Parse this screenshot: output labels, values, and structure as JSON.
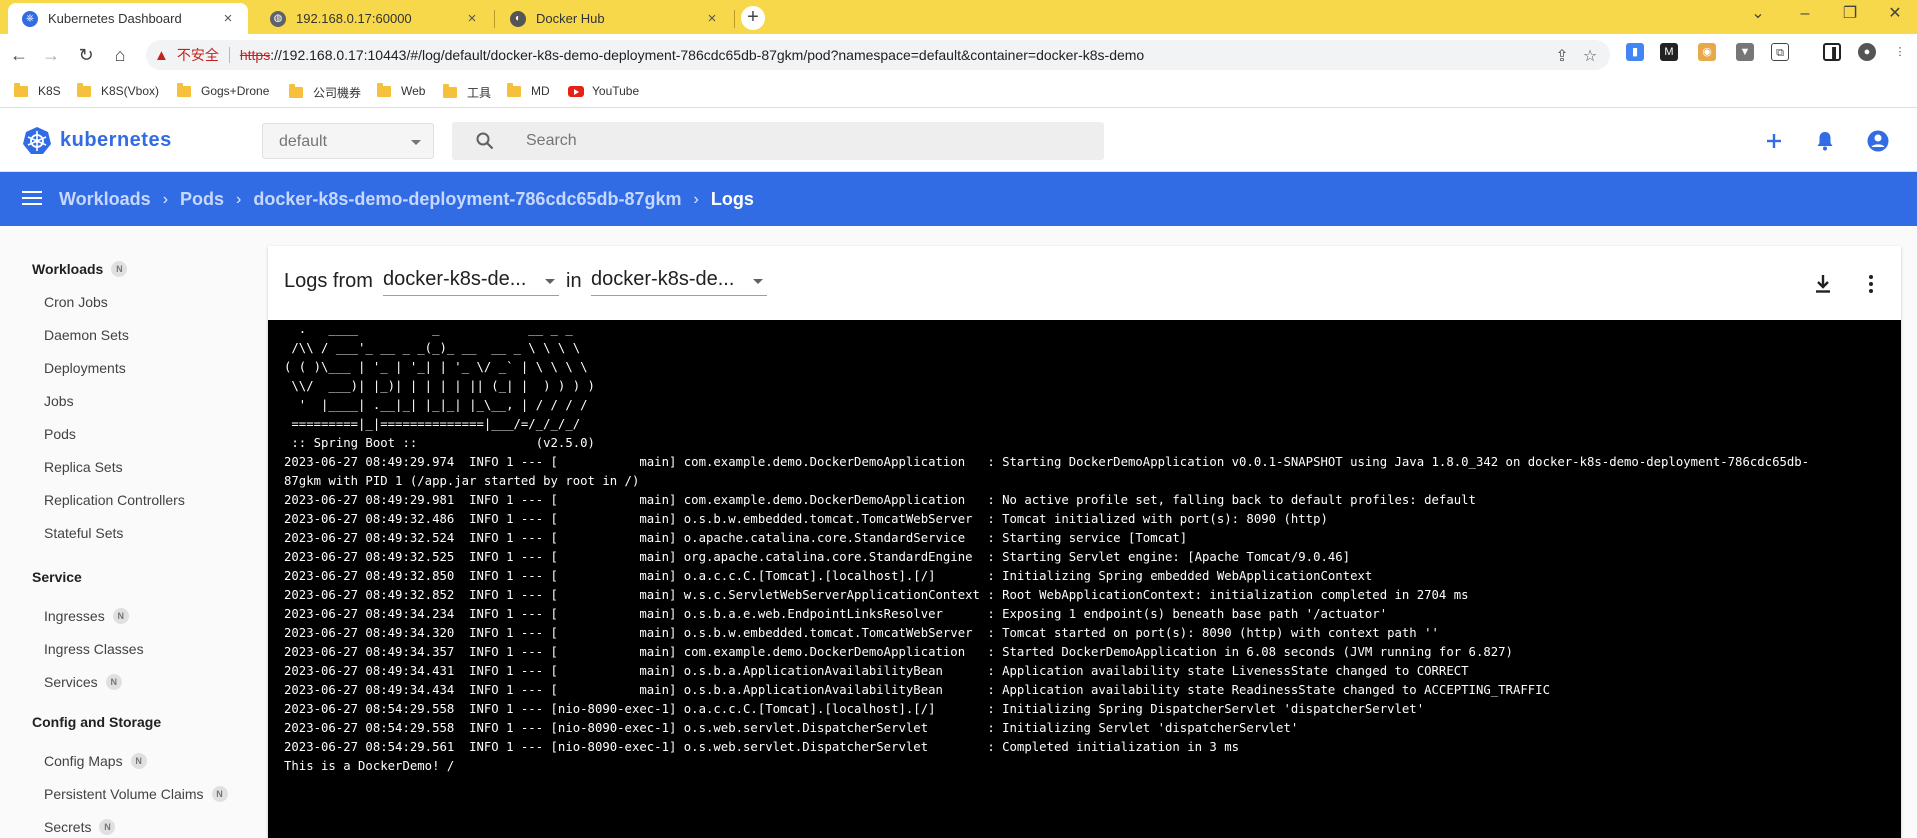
{
  "browser": {
    "tabs": [
      {
        "title": "Kubernetes Dashboard",
        "active": true
      },
      {
        "title": "192.168.0.17:60000",
        "active": false
      },
      {
        "title": "Docker Hub",
        "active": false
      }
    ],
    "address": {
      "security_label": "不安全",
      "protocol": "https",
      "url_rest": "://192.168.0.17:10443/#/log/default/docker-k8s-demo-deployment-786cdc65db-87gkm/pod?namespace=default&container=docker-k8s-demo"
    },
    "bookmarks": [
      "K8S",
      "K8S(Vbox)",
      "Gogs+Drone",
      "公司機券",
      "Web",
      "工具",
      "MD",
      "YouTube"
    ]
  },
  "header": {
    "brand": "kubernetes",
    "namespace": "default",
    "search_placeholder": "Search"
  },
  "breadcrumb": {
    "items": [
      "Workloads",
      "Pods",
      "docker-k8s-demo-deployment-786cdc65db-87gkm"
    ],
    "current": "Logs"
  },
  "sidebar": {
    "sections": [
      {
        "title": "Workloads",
        "badge": "N",
        "items": [
          {
            "label": "Cron Jobs"
          },
          {
            "label": "Daemon Sets"
          },
          {
            "label": "Deployments"
          },
          {
            "label": "Jobs"
          },
          {
            "label": "Pods"
          },
          {
            "label": "Replica Sets"
          },
          {
            "label": "Replication Controllers"
          },
          {
            "label": "Stateful Sets"
          }
        ]
      },
      {
        "title": "Service",
        "items": [
          {
            "label": "Ingresses",
            "badge": "N"
          },
          {
            "label": "Ingress Classes"
          },
          {
            "label": "Services",
            "badge": "N"
          }
        ]
      },
      {
        "title": "Config and Storage",
        "items": [
          {
            "label": "Config Maps",
            "badge": "N"
          },
          {
            "label": "Persistent Volume Claims",
            "badge": "N"
          },
          {
            "label": "Secrets",
            "badge": "N"
          }
        ]
      }
    ]
  },
  "logs": {
    "from_label": "Logs from",
    "pod_select": "docker-k8s-de...",
    "in_label": "in",
    "container_select": "docker-k8s-de...",
    "lines": [
      "  .   ____          _            __ _ _",
      " /\\\\ / ___'_ __ _ _(_)_ __  __ _ \\ \\ \\ \\",
      "( ( )\\___ | '_ | '_| | '_ \\/ _` | \\ \\ \\ \\",
      " \\\\/  ___)| |_)| | | | | || (_| |  ) ) ) )",
      "  '  |____| .__|_| |_|_| |_\\__, | / / / /",
      " =========|_|==============|___/=/_/_/_/",
      " :: Spring Boot ::                (v2.5.0)",
      "2023-06-27 08:49:29.974  INFO 1 --- [           main] com.example.demo.DockerDemoApplication   : Starting DockerDemoApplication v0.0.1-SNAPSHOT using Java 1.8.0_342 on docker-k8s-demo-deployment-786cdc65db-",
      "87gkm with PID 1 (/app.jar started by root in /)",
      "2023-06-27 08:49:29.981  INFO 1 --- [           main] com.example.demo.DockerDemoApplication   : No active profile set, falling back to default profiles: default",
      "2023-06-27 08:49:32.486  INFO 1 --- [           main] o.s.b.w.embedded.tomcat.TomcatWebServer  : Tomcat initialized with port(s): 8090 (http)",
      "2023-06-27 08:49:32.524  INFO 1 --- [           main] o.apache.catalina.core.StandardService   : Starting service [Tomcat]",
      "2023-06-27 08:49:32.525  INFO 1 --- [           main] org.apache.catalina.core.StandardEngine  : Starting Servlet engine: [Apache Tomcat/9.0.46]",
      "2023-06-27 08:49:32.850  INFO 1 --- [           main] o.a.c.c.C.[Tomcat].[localhost].[/]       : Initializing Spring embedded WebApplicationContext",
      "2023-06-27 08:49:32.852  INFO 1 --- [           main] w.s.c.ServletWebServerApplicationContext : Root WebApplicationContext: initialization completed in 2704 ms",
      "2023-06-27 08:49:34.234  INFO 1 --- [           main] o.s.b.a.e.web.EndpointLinksResolver      : Exposing 1 endpoint(s) beneath base path '/actuator'",
      "2023-06-27 08:49:34.320  INFO 1 --- [           main] o.s.b.w.embedded.tomcat.TomcatWebServer  : Tomcat started on port(s): 8090 (http) with context path ''",
      "2023-06-27 08:49:34.357  INFO 1 --- [           main] com.example.demo.DockerDemoApplication   : Started DockerDemoApplication in 6.08 seconds (JVM running for 6.827)",
      "2023-06-27 08:49:34.431  INFO 1 --- [           main] o.s.b.a.ApplicationAvailabilityBean      : Application availability state LivenessState changed to CORRECT",
      "2023-06-27 08:49:34.434  INFO 1 --- [           main] o.s.b.a.ApplicationAvailabilityBean      : Application availability state ReadinessState changed to ACCEPTING_TRAFFIC",
      "2023-06-27 08:54:29.558  INFO 1 --- [nio-8090-exec-1] o.a.c.c.C.[Tomcat].[localhost].[/]       : Initializing Spring DispatcherServlet 'dispatcherServlet'",
      "2023-06-27 08:54:29.558  INFO 1 --- [nio-8090-exec-1] o.s.web.servlet.DispatcherServlet        : Initializing Servlet 'dispatcherServlet'",
      "2023-06-27 08:54:29.561  INFO 1 --- [nio-8090-exec-1] o.s.web.servlet.DispatcherServlet        : Completed initialization in 3 ms",
      "This is a DockerDemo! /"
    ]
  },
  "colors": {
    "tabstrip": "#f7d84a",
    "k8s_blue": "#326ce5",
    "terminal_bg": "#000000"
  }
}
